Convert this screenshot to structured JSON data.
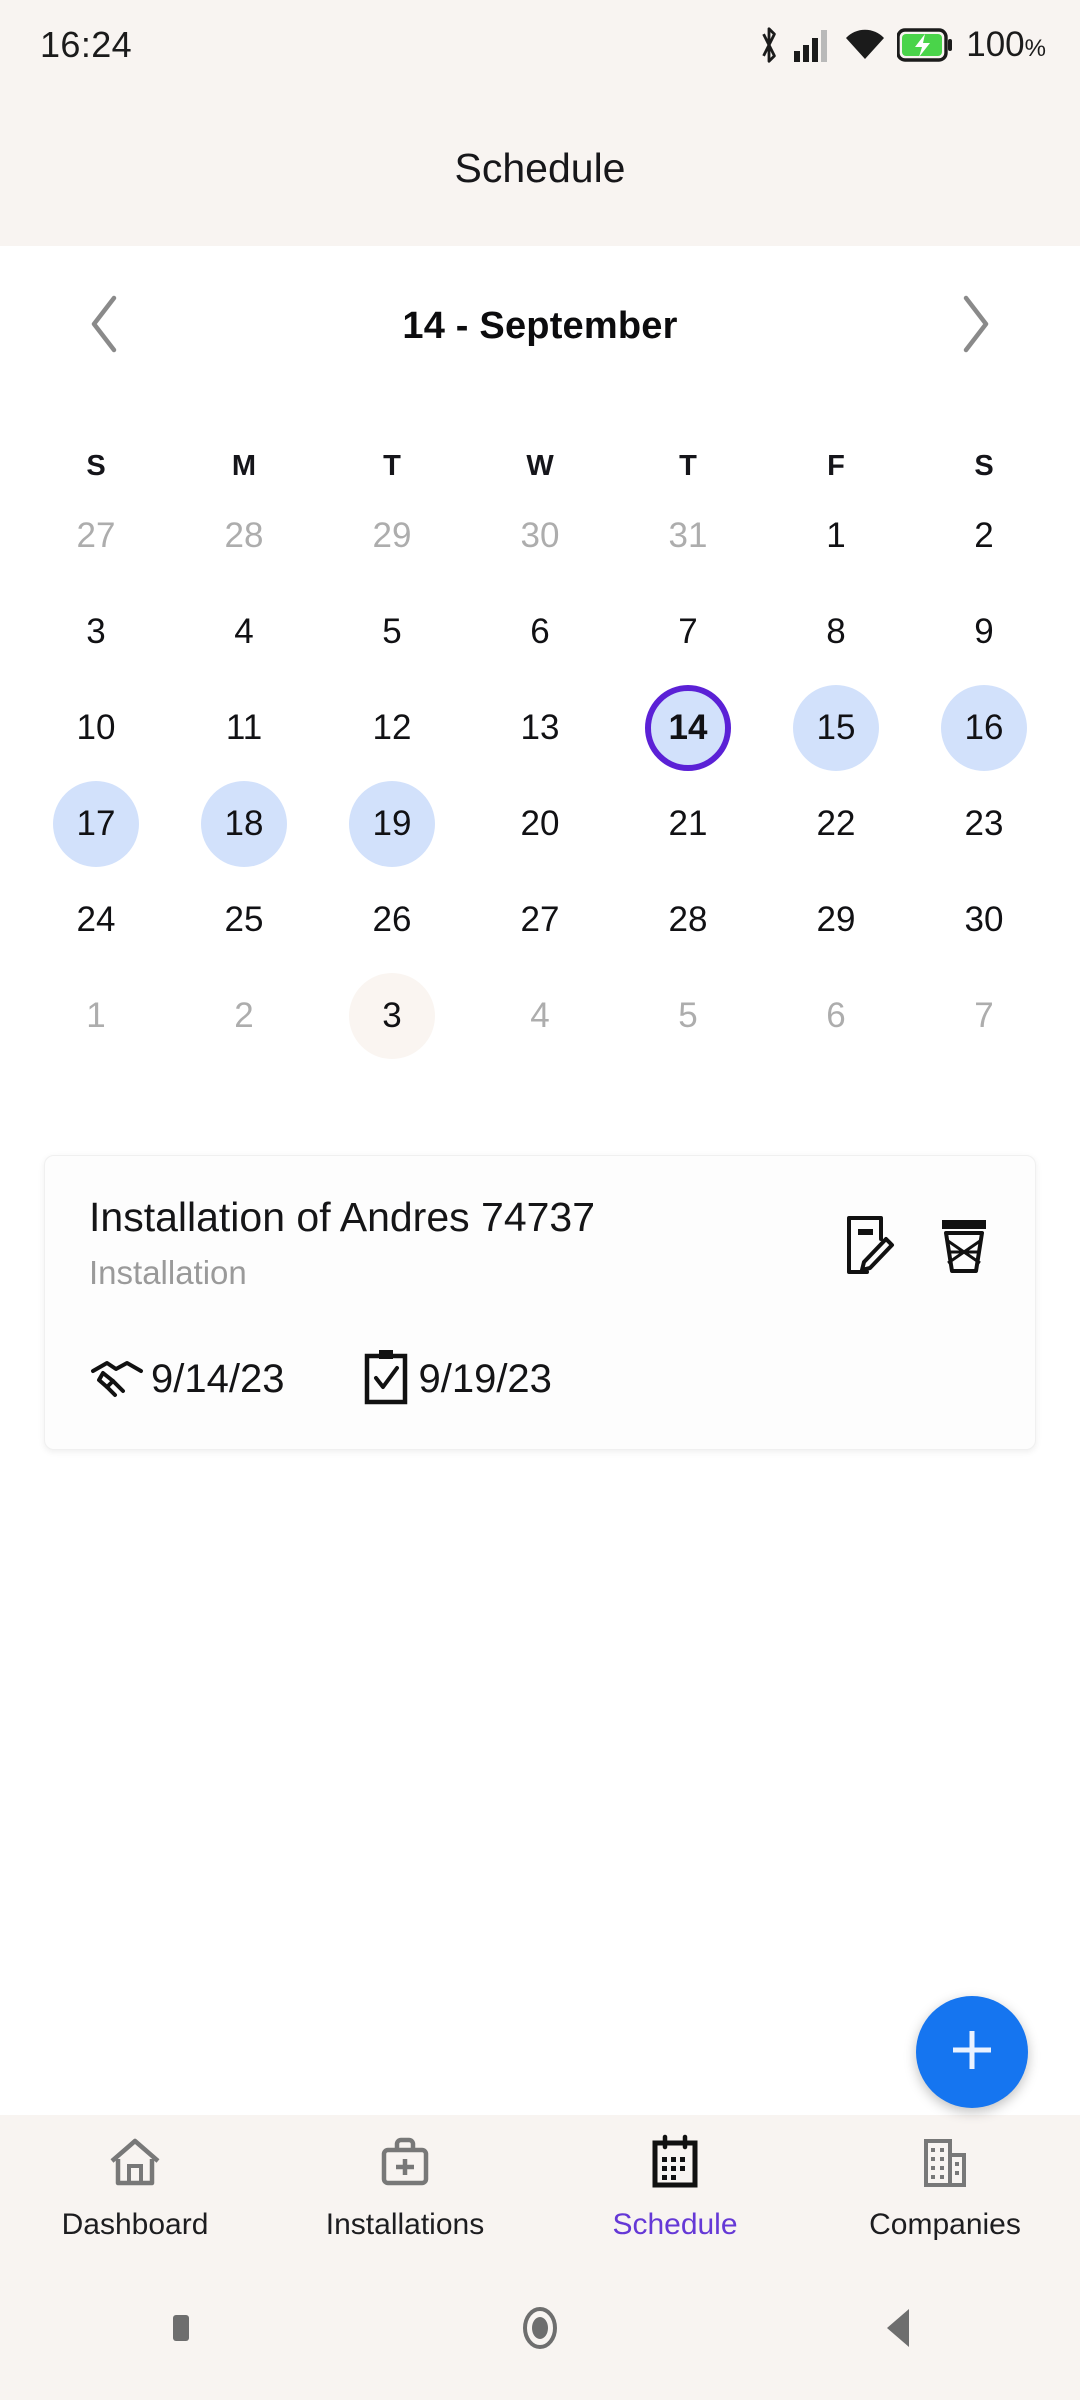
{
  "status_bar": {
    "time": "16:24",
    "battery_percent": "100",
    "percent_sign": "%",
    "icons": [
      "bluetooth-icon",
      "cellular-signal-icon",
      "wifi-icon",
      "battery-charging-icon"
    ]
  },
  "app_bar": {
    "title": "Schedule"
  },
  "calendar": {
    "prev_label": "‹",
    "next_label": "›",
    "title": "14 - September",
    "weekday_labels": [
      "S",
      "M",
      "T",
      "W",
      "T",
      "F",
      "S"
    ],
    "weeks": [
      [
        {
          "label": "27",
          "state": "muted"
        },
        {
          "label": "28",
          "state": "muted"
        },
        {
          "label": "29",
          "state": "muted"
        },
        {
          "label": "30",
          "state": "muted"
        },
        {
          "label": "31",
          "state": "muted"
        },
        {
          "label": "1",
          "state": "normal"
        },
        {
          "label": "2",
          "state": "normal"
        }
      ],
      [
        {
          "label": "3",
          "state": "normal"
        },
        {
          "label": "4",
          "state": "normal"
        },
        {
          "label": "5",
          "state": "normal"
        },
        {
          "label": "6",
          "state": "normal"
        },
        {
          "label": "7",
          "state": "normal"
        },
        {
          "label": "8",
          "state": "normal"
        },
        {
          "label": "9",
          "state": "normal"
        }
      ],
      [
        {
          "label": "10",
          "state": "normal"
        },
        {
          "label": "11",
          "state": "normal"
        },
        {
          "label": "12",
          "state": "normal"
        },
        {
          "label": "13",
          "state": "normal"
        },
        {
          "label": "14",
          "state": "selected"
        },
        {
          "label": "15",
          "state": "range"
        },
        {
          "label": "16",
          "state": "range"
        }
      ],
      [
        {
          "label": "17",
          "state": "range"
        },
        {
          "label": "18",
          "state": "range"
        },
        {
          "label": "19",
          "state": "range"
        },
        {
          "label": "20",
          "state": "normal"
        },
        {
          "label": "21",
          "state": "normal"
        },
        {
          "label": "22",
          "state": "normal"
        },
        {
          "label": "23",
          "state": "normal"
        }
      ],
      [
        {
          "label": "24",
          "state": "normal"
        },
        {
          "label": "25",
          "state": "normal"
        },
        {
          "label": "26",
          "state": "normal"
        },
        {
          "label": "27",
          "state": "normal"
        },
        {
          "label": "28",
          "state": "normal"
        },
        {
          "label": "29",
          "state": "normal"
        },
        {
          "label": "30",
          "state": "normal"
        }
      ],
      [
        {
          "label": "1",
          "state": "muted"
        },
        {
          "label": "2",
          "state": "muted"
        },
        {
          "label": "3",
          "state": "today"
        },
        {
          "label": "4",
          "state": "muted"
        },
        {
          "label": "5",
          "state": "muted"
        },
        {
          "label": "6",
          "state": "muted"
        },
        {
          "label": "7",
          "state": "muted"
        }
      ]
    ]
  },
  "event_card": {
    "title": "Installation of Andres 74737",
    "subtitle": "Installation",
    "start_date": "9/14/23",
    "end_date": "9/19/23",
    "start_icon": "handshake-icon",
    "end_icon": "clipboard-check-icon",
    "edit_icon": "edit-note-icon",
    "delete_icon": "trash-icon"
  },
  "fab": {
    "label": "+",
    "icon": "plus-icon",
    "color": "#1575f0"
  },
  "bottom_nav": {
    "items": [
      {
        "label": "Dashboard",
        "icon": "home-icon",
        "active": false
      },
      {
        "label": "Installations",
        "icon": "briefcase-icon",
        "active": false
      },
      {
        "label": "Schedule",
        "icon": "calendar-icon",
        "active": true
      },
      {
        "label": "Companies",
        "icon": "buildings-icon",
        "active": false
      }
    ],
    "active_color": "#6538d6"
  },
  "system_nav": {
    "items": [
      "recents-icon",
      "home-circle-icon",
      "back-triangle-icon"
    ]
  },
  "theme": {
    "surface": "#f8f4f1",
    "accent_purple": "#5b21d6",
    "range_blue": "#d2e1fb",
    "fab_blue": "#1575f0"
  }
}
